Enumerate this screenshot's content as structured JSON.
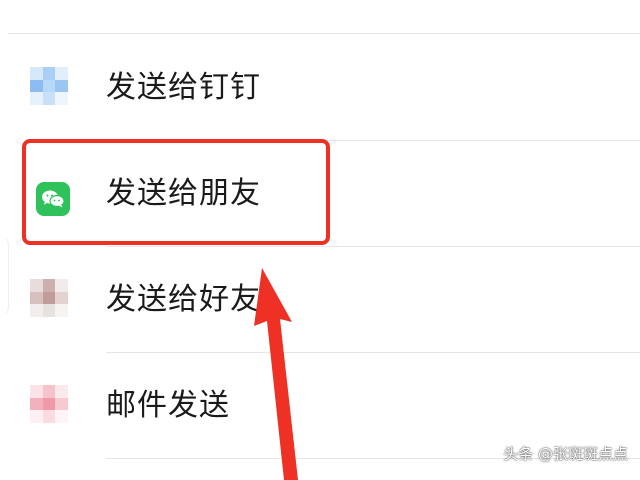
{
  "share_menu": {
    "items": [
      {
        "label": "发送给钉钉",
        "icon": "dingtalk-icon"
      },
      {
        "label": "发送给朋友",
        "icon": "wechat-icon"
      },
      {
        "label": "发送给好友",
        "icon": "friend-app-icon"
      },
      {
        "label": "邮件发送",
        "icon": "mail-app-icon"
      }
    ]
  },
  "annotation": {
    "highlight_color": "#ee3124",
    "arrow_color": "#ee3124",
    "highlighted_item": "发送给朋友"
  },
  "watermark": {
    "text": "头条 @张斑斑点点"
  },
  "colors": {
    "wechat_green": "#2fc25b",
    "divider": "#e6e6e6"
  }
}
